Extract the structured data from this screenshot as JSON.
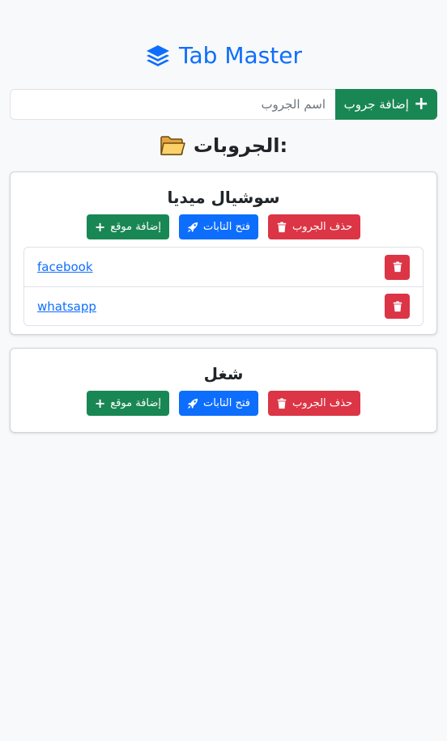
{
  "app": {
    "title": "Tab Master",
    "icon": "layers-icon",
    "accent": "#0d6efd"
  },
  "add_group": {
    "placeholder": "اسم الجروب",
    "button_label": "إضافة جروب",
    "button_icon": "plus-icon"
  },
  "groups_section": {
    "title": "الجروبات:",
    "icon": "folder-icon"
  },
  "groups": [
    {
      "name": "سوشيال ميديا",
      "delete_label": "حذف الجروب",
      "open_label": "فتح التابات",
      "add_site_label": "إضافة موقع",
      "sites": [
        {
          "label": "facebook"
        },
        {
          "label": "whatsapp"
        }
      ]
    },
    {
      "name": "شغل",
      "delete_label": "حذف الجروب",
      "open_label": "فتح التابات",
      "add_site_label": "إضافة موقع",
      "sites": []
    }
  ],
  "colors": {
    "green": "#198754",
    "blue": "#0d6efd",
    "red": "#dc3545"
  }
}
